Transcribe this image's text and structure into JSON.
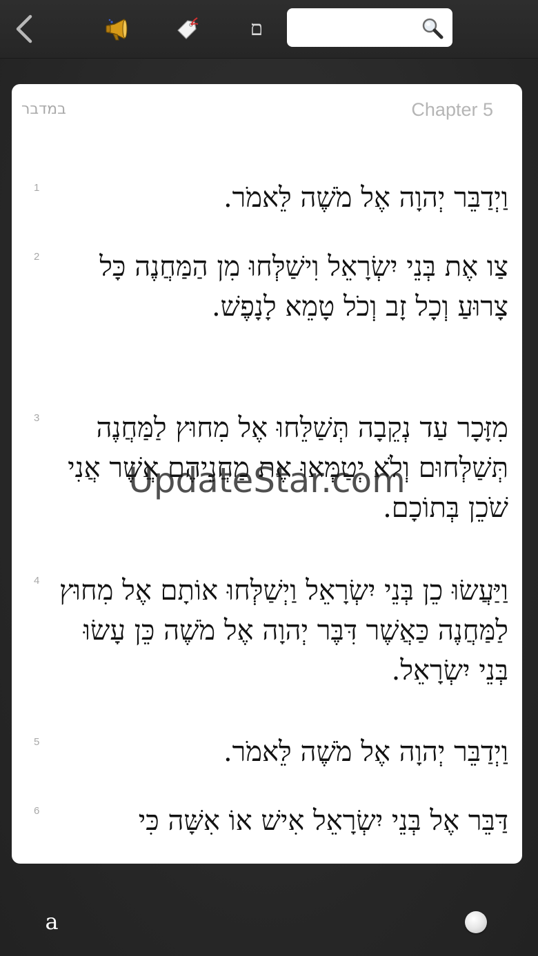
{
  "toolbar": {
    "back_icon": "chevron-left-icon",
    "speaker_icon": "megaphone-icon",
    "tag_icon": "tag-icon",
    "mem_label": "ם",
    "search": {
      "placeholder": "",
      "value": "",
      "icon": "magnifier-icon"
    }
  },
  "page": {
    "book_name": "במדבר",
    "chapter": "Chapter 5",
    "verses": [
      {
        "num": "1",
        "text": "וַיְדַבֵּר יְהוָה אֶל מֹשֶׁה לֵּאמֹר."
      },
      {
        "num": "2",
        "text": "צַו אֶת בְּנֵי יִשְׂרָאֵל וִישַׁלְּחוּ מִן הַמַּחֲנֶה כָּל צָרוּעַ וְכָל זָב וְכֹל טָמֵא לָנָפֶשׁ."
      },
      {
        "num": "3",
        "text": "מִזָּכָר עַד נְקֵבָה תְּשַׁלֵּחוּ אֶל מִחוּץ לַמַּחֲנֶה תְּשַׁלְּחוּם וְלֹא יְטַמְּאוּ אֶת מַחֲנֵיהֶם אֲשֶׁר אֲנִי שֹׁכֵן בְּתוֹכָם."
      },
      {
        "num": "4",
        "text": "וַיַּעֲשׂוּ כֵן בְּנֵי יִשְׂרָאֵל וַיְשַׁלְּחוּ אוֹתָם אֶל מִחוּץ לַמַּחֲנֶה כַּאֲשֶׁר דִּבֶּר יְהוָה אֶל מֹשֶׁה כֵּן עָשׂוּ בְּנֵי יִשְׂרָאֵל."
      },
      {
        "num": "5",
        "text": "וַיְדַבֵּר יְהוָה אֶל מֹשֶׁה לֵּאמֹר."
      },
      {
        "num": "6",
        "text": "דַּבֵּר אֶל בְּנֵי יִשְׂרָאֵל אִישׁ אוֹ אִשָּׁה כִּי"
      }
    ]
  },
  "watermark": "UpdateStar.com",
  "bottom": {
    "font_button": "a",
    "brightness_icon": "brightness-knob-icon"
  }
}
